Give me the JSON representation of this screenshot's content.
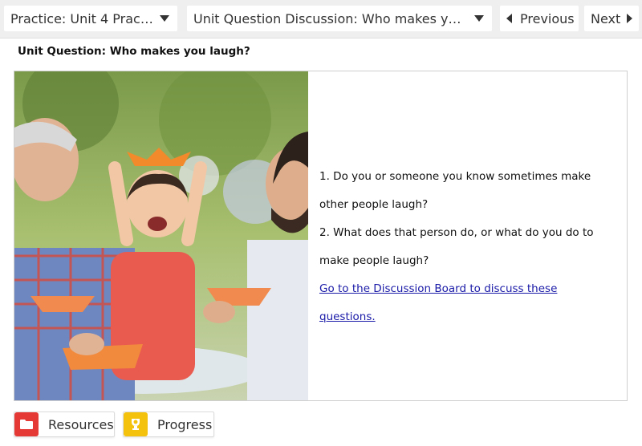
{
  "header": {
    "practice_select": "Practice: Unit 4 Practice",
    "activity_select": "Unit Question Discussion: Who makes you l...",
    "previous_label": "Previous",
    "next_label": "Next"
  },
  "main": {
    "title": "Unit Question: Who makes you laugh?",
    "questions": [
      "1. Do you or someone you know sometimes make other people laugh?",
      "2. What does that person do, or what do you do to make people laugh?"
    ],
    "link_text": "Go to the Discussion Board to discuss these questions."
  },
  "footer": {
    "resources_label": "Resources",
    "progress_label": "Progress"
  },
  "icons": {
    "resources": "folder-icon",
    "progress": "trophy-icon"
  },
  "colors": {
    "resources_icon_bg": "#e53935",
    "progress_icon_bg": "#f4c20d",
    "link": "#1a1aa8"
  }
}
